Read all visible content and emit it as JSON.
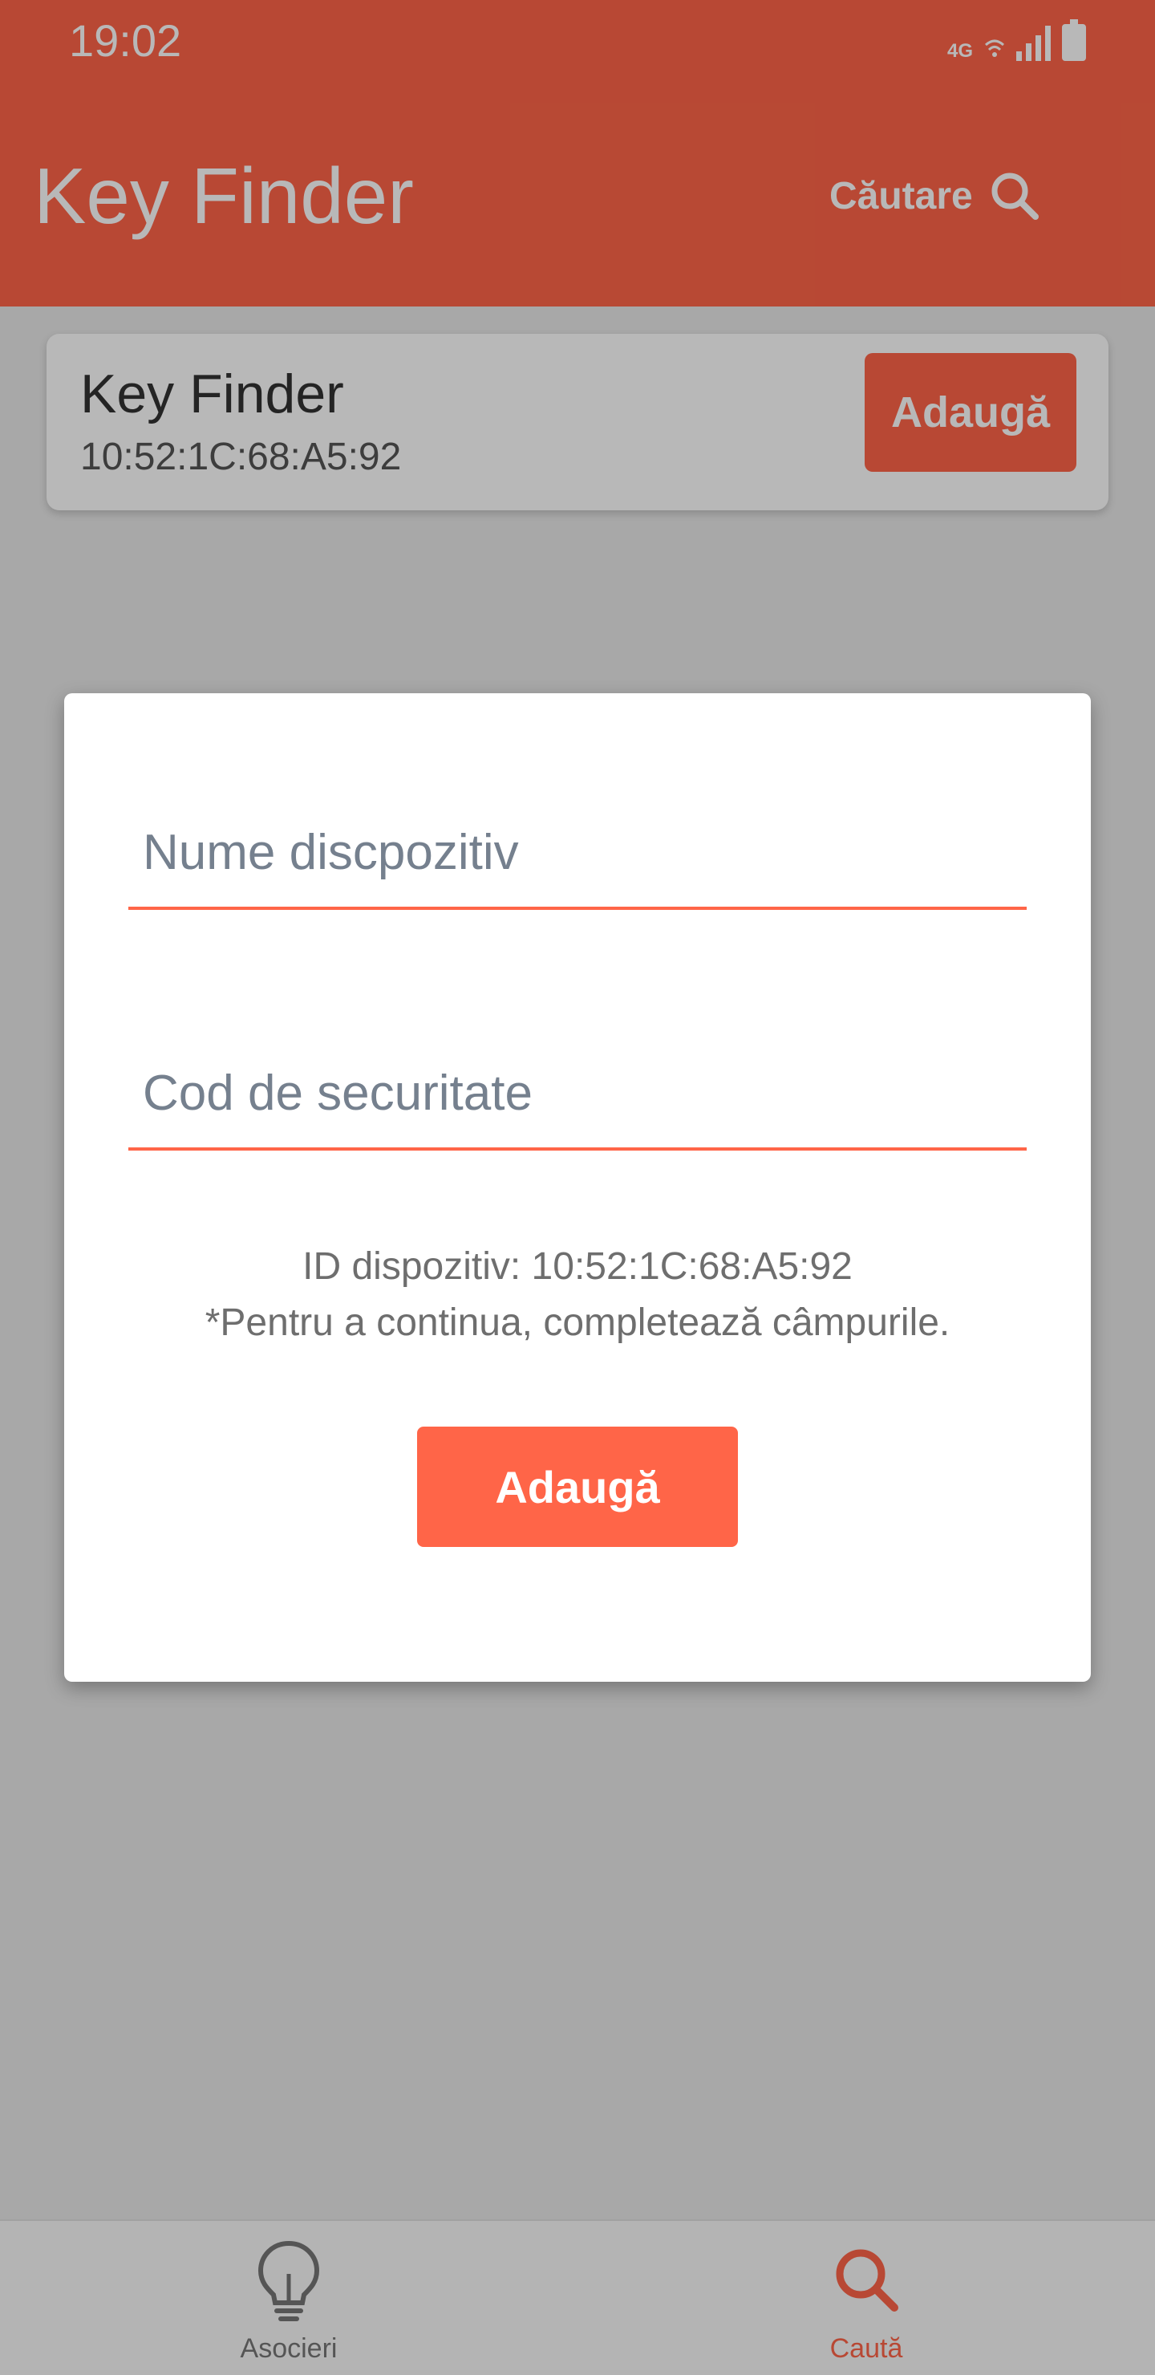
{
  "status_bar": {
    "time": "19:02",
    "network": "4G",
    "icons": [
      "wifi-icon",
      "signal-icon",
      "battery-charging-icon"
    ]
  },
  "app_bar": {
    "title": "Key Finder",
    "search_label": "Căutare",
    "search_icon": "search-icon"
  },
  "device_card": {
    "name": "Key Finder",
    "mac": "10:52:1C:68:A5:92",
    "add_label": "Adaugă"
  },
  "dialog": {
    "name_placeholder": "Nume discpozitiv",
    "name_value": "",
    "code_placeholder": "Cod de securitate",
    "code_value": "",
    "device_id_line": "ID dispozitiv: 10:52:1C:68:A5:92",
    "hint_line": "*Pentru a continua, completează câmpurile.",
    "add_label": "Adaugă"
  },
  "bottom_nav": {
    "items": [
      {
        "label": "Asocieri",
        "icon": "lightbulb-icon",
        "active": false
      },
      {
        "label": "Caută",
        "icon": "search-icon",
        "active": true
      }
    ]
  },
  "colors": {
    "accent": "#ff6548",
    "scrim": "rgba(0,0,0,0.28)"
  }
}
